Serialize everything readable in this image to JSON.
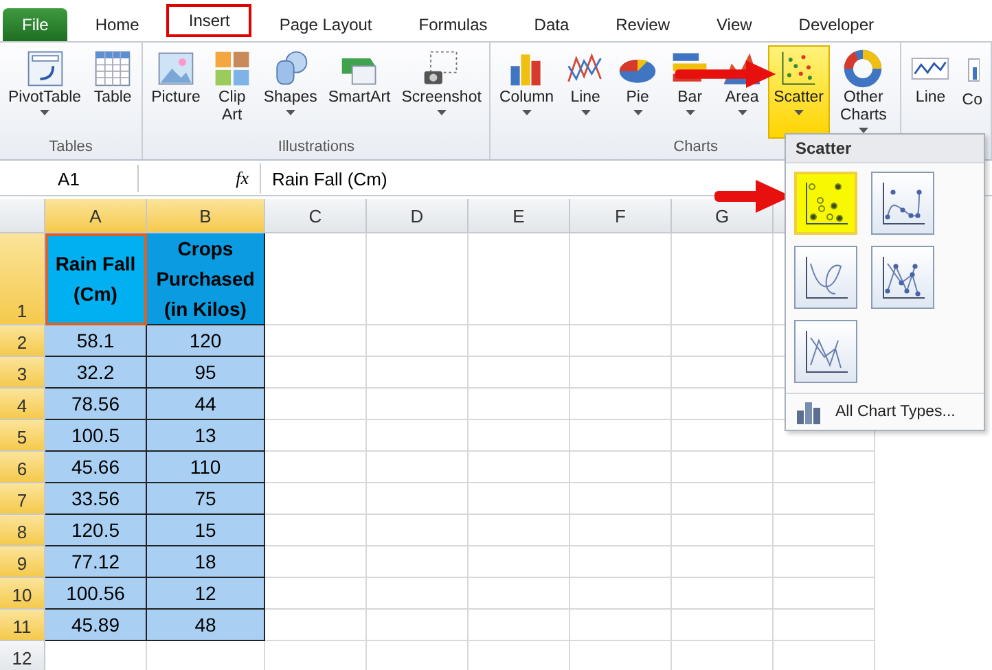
{
  "tabs": [
    {
      "label": "File",
      "kind": "file",
      "selected": false
    },
    {
      "label": "Home",
      "kind": "tab",
      "selected": false
    },
    {
      "label": "Insert",
      "kind": "tab",
      "selected": true
    },
    {
      "label": "Page Layout",
      "kind": "tab",
      "selected": false
    },
    {
      "label": "Formulas",
      "kind": "tab",
      "selected": false
    },
    {
      "label": "Data",
      "kind": "tab",
      "selected": false
    },
    {
      "label": "Review",
      "kind": "tab",
      "selected": false
    },
    {
      "label": "View",
      "kind": "tab",
      "selected": false
    },
    {
      "label": "Developer",
      "kind": "tab",
      "selected": false
    }
  ],
  "ribbon_groups": [
    {
      "label": "Tables",
      "buttons": [
        {
          "label": "PivotTable",
          "kind": "pivot",
          "dropdown": true,
          "selected": false
        },
        {
          "label": "Table",
          "kind": "table",
          "dropdown": false,
          "selected": false
        }
      ]
    },
    {
      "label": "Illustrations",
      "buttons": [
        {
          "label": "Picture",
          "kind": "picture",
          "dropdown": false,
          "selected": false
        },
        {
          "label": "Clip Art",
          "kind": "clipart",
          "dropdown": false,
          "selected": false
        },
        {
          "label": "Shapes",
          "kind": "shapes",
          "dropdown": true,
          "selected": false
        },
        {
          "label": "SmartArt",
          "kind": "smartart",
          "dropdown": false,
          "selected": false
        },
        {
          "label": "Screenshot",
          "kind": "screenshot",
          "dropdown": true,
          "selected": false
        }
      ]
    },
    {
      "label": "Charts",
      "buttons": [
        {
          "label": "Column",
          "kind": "column",
          "dropdown": true,
          "selected": false
        },
        {
          "label": "Line",
          "kind": "line",
          "dropdown": true,
          "selected": false
        },
        {
          "label": "Pie",
          "kind": "pie",
          "dropdown": true,
          "selected": false
        },
        {
          "label": "Bar",
          "kind": "bar",
          "dropdown": true,
          "selected": false
        },
        {
          "label": "Area",
          "kind": "area",
          "dropdown": true,
          "selected": false
        },
        {
          "label": "Scatter",
          "kind": "scatter",
          "dropdown": true,
          "selected": true
        },
        {
          "label": "Other Charts",
          "kind": "donut",
          "dropdown": true,
          "selected": false
        }
      ]
    },
    {
      "buttons": [
        {
          "label": "Line",
          "kind": "sparkline",
          "dropdown": false,
          "selected": false
        },
        {
          "label": "Co",
          "kind": "sparkcolumn",
          "dropdown": false,
          "selected": false
        }
      ]
    }
  ],
  "formula_bar": {
    "name_box": "A1",
    "fx": "fx",
    "formula": "Rain Fall (Cm)"
  },
  "columns": [
    {
      "label": "A",
      "selected": true
    },
    {
      "label": "B",
      "selected": true
    },
    {
      "label": "C",
      "selected": false
    },
    {
      "label": "D",
      "selected": false
    },
    {
      "label": "E",
      "selected": false
    },
    {
      "label": "F",
      "selected": false
    },
    {
      "label": "G",
      "selected": false
    }
  ],
  "header_row": {
    "row": "1",
    "selected": true,
    "cells": [
      "Rain Fall (Cm)",
      "Crops Purchased (in Kilos)"
    ]
  },
  "rows": [
    {
      "row": "2",
      "selected": true,
      "cells": [
        "58.1",
        "120"
      ]
    },
    {
      "row": "3",
      "selected": true,
      "cells": [
        "32.2",
        "95"
      ]
    },
    {
      "row": "4",
      "selected": true,
      "cells": [
        "78.56",
        "44"
      ]
    },
    {
      "row": "5",
      "selected": true,
      "cells": [
        "100.5",
        "13"
      ]
    },
    {
      "row": "6",
      "selected": true,
      "cells": [
        "45.66",
        "110"
      ]
    },
    {
      "row": "7",
      "selected": true,
      "cells": [
        "33.56",
        "75"
      ]
    },
    {
      "row": "8",
      "selected": true,
      "cells": [
        "120.5",
        "15"
      ]
    },
    {
      "row": "9",
      "selected": true,
      "cells": [
        "77.12",
        "18"
      ]
    },
    {
      "row": "10",
      "selected": true,
      "cells": [
        "100.56",
        "12"
      ]
    },
    {
      "row": "11",
      "selected": true,
      "cells": [
        "45.89",
        "48"
      ]
    },
    {
      "row": "12",
      "selected": false,
      "cells": [
        "",
        ""
      ]
    }
  ],
  "dropdown": {
    "title": "Scatter",
    "options": [
      {
        "kind": "markers",
        "selected": true
      },
      {
        "kind": "smooth-markers",
        "selected": false
      },
      {
        "kind": "smooth",
        "selected": false
      },
      {
        "kind": "straight-markers",
        "selected": false
      },
      {
        "kind": "straight",
        "selected": false
      }
    ],
    "footer": "All Chart Types..."
  }
}
